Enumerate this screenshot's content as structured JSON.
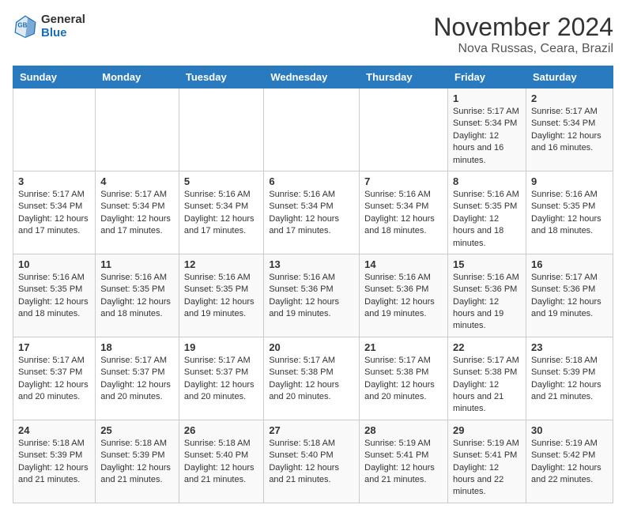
{
  "header": {
    "logo_general": "General",
    "logo_blue": "Blue",
    "month_title": "November 2024",
    "location": "Nova Russas, Ceara, Brazil"
  },
  "weekdays": [
    "Sunday",
    "Monday",
    "Tuesday",
    "Wednesday",
    "Thursday",
    "Friday",
    "Saturday"
  ],
  "weeks": [
    [
      {
        "day": "",
        "info": ""
      },
      {
        "day": "",
        "info": ""
      },
      {
        "day": "",
        "info": ""
      },
      {
        "day": "",
        "info": ""
      },
      {
        "day": "",
        "info": ""
      },
      {
        "day": "1",
        "info": "Sunrise: 5:17 AM\nSunset: 5:34 PM\nDaylight: 12 hours and 16 minutes."
      },
      {
        "day": "2",
        "info": "Sunrise: 5:17 AM\nSunset: 5:34 PM\nDaylight: 12 hours and 16 minutes."
      }
    ],
    [
      {
        "day": "3",
        "info": "Sunrise: 5:17 AM\nSunset: 5:34 PM\nDaylight: 12 hours and 17 minutes."
      },
      {
        "day": "4",
        "info": "Sunrise: 5:17 AM\nSunset: 5:34 PM\nDaylight: 12 hours and 17 minutes."
      },
      {
        "day": "5",
        "info": "Sunrise: 5:16 AM\nSunset: 5:34 PM\nDaylight: 12 hours and 17 minutes."
      },
      {
        "day": "6",
        "info": "Sunrise: 5:16 AM\nSunset: 5:34 PM\nDaylight: 12 hours and 17 minutes."
      },
      {
        "day": "7",
        "info": "Sunrise: 5:16 AM\nSunset: 5:34 PM\nDaylight: 12 hours and 18 minutes."
      },
      {
        "day": "8",
        "info": "Sunrise: 5:16 AM\nSunset: 5:35 PM\nDaylight: 12 hours and 18 minutes."
      },
      {
        "day": "9",
        "info": "Sunrise: 5:16 AM\nSunset: 5:35 PM\nDaylight: 12 hours and 18 minutes."
      }
    ],
    [
      {
        "day": "10",
        "info": "Sunrise: 5:16 AM\nSunset: 5:35 PM\nDaylight: 12 hours and 18 minutes."
      },
      {
        "day": "11",
        "info": "Sunrise: 5:16 AM\nSunset: 5:35 PM\nDaylight: 12 hours and 18 minutes."
      },
      {
        "day": "12",
        "info": "Sunrise: 5:16 AM\nSunset: 5:35 PM\nDaylight: 12 hours and 19 minutes."
      },
      {
        "day": "13",
        "info": "Sunrise: 5:16 AM\nSunset: 5:36 PM\nDaylight: 12 hours and 19 minutes."
      },
      {
        "day": "14",
        "info": "Sunrise: 5:16 AM\nSunset: 5:36 PM\nDaylight: 12 hours and 19 minutes."
      },
      {
        "day": "15",
        "info": "Sunrise: 5:16 AM\nSunset: 5:36 PM\nDaylight: 12 hours and 19 minutes."
      },
      {
        "day": "16",
        "info": "Sunrise: 5:17 AM\nSunset: 5:36 PM\nDaylight: 12 hours and 19 minutes."
      }
    ],
    [
      {
        "day": "17",
        "info": "Sunrise: 5:17 AM\nSunset: 5:37 PM\nDaylight: 12 hours and 20 minutes."
      },
      {
        "day": "18",
        "info": "Sunrise: 5:17 AM\nSunset: 5:37 PM\nDaylight: 12 hours and 20 minutes."
      },
      {
        "day": "19",
        "info": "Sunrise: 5:17 AM\nSunset: 5:37 PM\nDaylight: 12 hours and 20 minutes."
      },
      {
        "day": "20",
        "info": "Sunrise: 5:17 AM\nSunset: 5:38 PM\nDaylight: 12 hours and 20 minutes."
      },
      {
        "day": "21",
        "info": "Sunrise: 5:17 AM\nSunset: 5:38 PM\nDaylight: 12 hours and 20 minutes."
      },
      {
        "day": "22",
        "info": "Sunrise: 5:17 AM\nSunset: 5:38 PM\nDaylight: 12 hours and 21 minutes."
      },
      {
        "day": "23",
        "info": "Sunrise: 5:18 AM\nSunset: 5:39 PM\nDaylight: 12 hours and 21 minutes."
      }
    ],
    [
      {
        "day": "24",
        "info": "Sunrise: 5:18 AM\nSunset: 5:39 PM\nDaylight: 12 hours and 21 minutes."
      },
      {
        "day": "25",
        "info": "Sunrise: 5:18 AM\nSunset: 5:39 PM\nDaylight: 12 hours and 21 minutes."
      },
      {
        "day": "26",
        "info": "Sunrise: 5:18 AM\nSunset: 5:40 PM\nDaylight: 12 hours and 21 minutes."
      },
      {
        "day": "27",
        "info": "Sunrise: 5:18 AM\nSunset: 5:40 PM\nDaylight: 12 hours and 21 minutes."
      },
      {
        "day": "28",
        "info": "Sunrise: 5:19 AM\nSunset: 5:41 PM\nDaylight: 12 hours and 21 minutes."
      },
      {
        "day": "29",
        "info": "Sunrise: 5:19 AM\nSunset: 5:41 PM\nDaylight: 12 hours and 22 minutes."
      },
      {
        "day": "30",
        "info": "Sunrise: 5:19 AM\nSunset: 5:42 PM\nDaylight: 12 hours and 22 minutes."
      }
    ]
  ]
}
